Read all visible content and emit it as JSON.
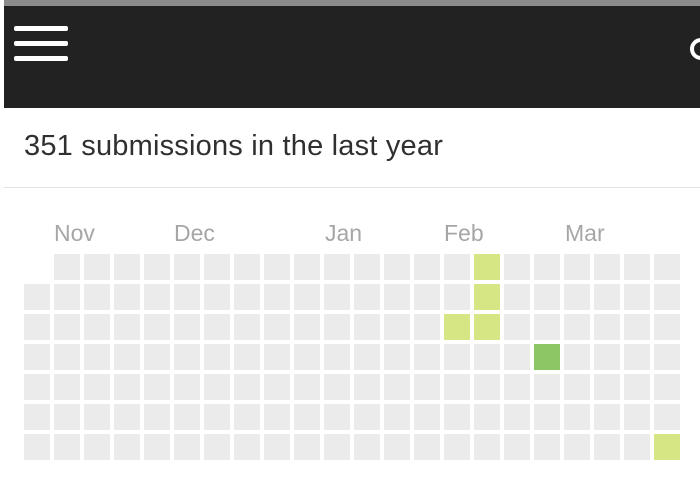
{
  "topbar": {
    "menu_icon": "hamburger-menu-icon",
    "search_icon": "search-icon",
    "background": "#222222"
  },
  "header": {
    "title": "351 submissions in the last year"
  },
  "heatmap": {
    "months": [
      "Nov",
      "Dec",
      "Jan",
      "Feb",
      "Mar"
    ],
    "empty_color": "#ebebeb",
    "level_colors": {
      "1": "#d6e685",
      "2": "#8cc665",
      "3": "#44a340"
    },
    "active_days": [
      {
        "week": 15,
        "day": 0,
        "level": 1
      },
      {
        "week": 15,
        "day": 1,
        "level": 1
      },
      {
        "week": 14,
        "day": 2,
        "level": 1
      },
      {
        "week": 15,
        "day": 2,
        "level": 1
      },
      {
        "week": 17,
        "day": 3,
        "level": 2
      },
      {
        "week": 21,
        "day": 6,
        "level": 1
      }
    ]
  }
}
